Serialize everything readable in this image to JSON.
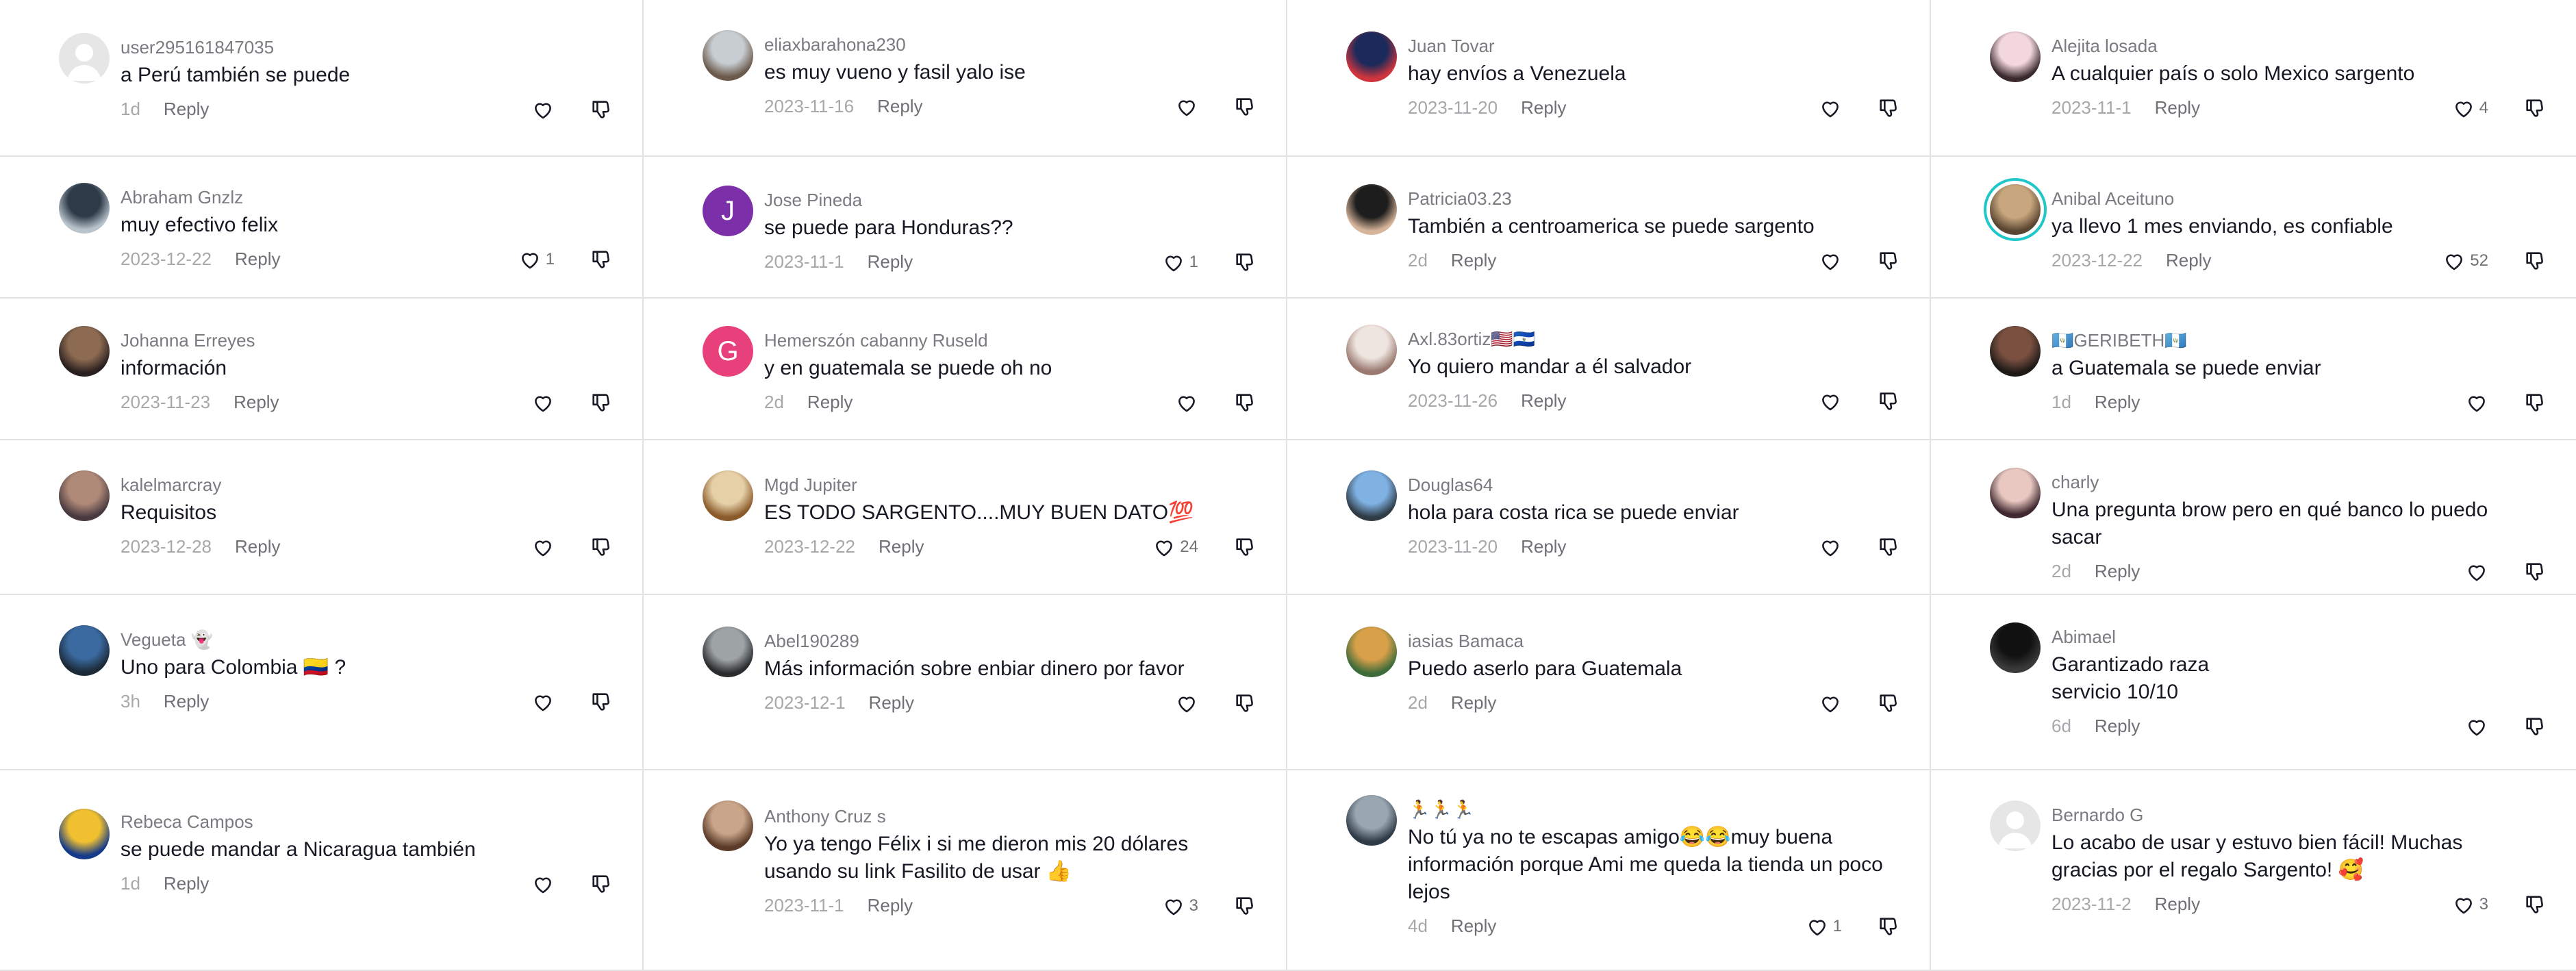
{
  "comments": [
    {
      "user": "user295161847035",
      "text": "a Perú también se puede",
      "date": "1d",
      "reply": "Reply",
      "likes": "",
      "avatar": {
        "type": "default"
      }
    },
    {
      "user": "eliaxbarahona230",
      "text": "es muy vueno y fasil yalo ise",
      "date": "2023-11-16",
      "reply": "Reply",
      "likes": "",
      "avatar": {
        "type": "photo",
        "colors": [
          "#c8cdd2",
          "#6b5a4c"
        ]
      }
    },
    {
      "user": "Juan Tovar",
      "text": "hay envíos a Venezuela",
      "date": "2023-11-20",
      "reply": "Reply",
      "likes": "",
      "avatar": {
        "type": "photo",
        "colors": [
          "#1b2a5a",
          "#d0353e"
        ]
      }
    },
    {
      "user": "Alejita losada",
      "text": "A cualquier país o solo Mexico sargento",
      "date": "2023-11-1",
      "reply": "Reply",
      "likes": "4",
      "avatar": {
        "type": "photo",
        "colors": [
          "#f3d7de",
          "#3a2a2e"
        ]
      }
    },
    {
      "user": "Abraham Gnzlz",
      "text": "muy efectivo felix",
      "date": "2023-12-22",
      "reply": "Reply",
      "likes": "1",
      "avatar": {
        "type": "photo",
        "colors": [
          "#2d3a47",
          "#b8c3cc"
        ]
      }
    },
    {
      "user": "Jose Pineda",
      "text": "se puede para Honduras??",
      "date": "2023-11-1",
      "reply": "Reply",
      "likes": "1",
      "avatar": {
        "type": "letter",
        "letter": "J",
        "color": "#7b2fa8"
      }
    },
    {
      "user": "Patricia03.23",
      "text": "También a centroamerica se puede sargento",
      "date": "2d",
      "reply": "Reply",
      "likes": "",
      "avatar": {
        "type": "photo",
        "colors": [
          "#1d1d1d",
          "#d7b59a"
        ]
      }
    },
    {
      "user": "Anibal Aceituno",
      "text": "ya llevo 1 mes enviando, es confiable",
      "date": "2023-12-22",
      "reply": "Reply",
      "likes": "52",
      "avatar": {
        "type": "photo",
        "ring": true,
        "colors": [
          "#c9a77e",
          "#5a4532"
        ]
      }
    },
    {
      "user": "Johanna Erreyes",
      "text": "información",
      "date": "2023-11-23",
      "reply": "Reply",
      "likes": "",
      "avatar": {
        "type": "photo",
        "colors": [
          "#8d6b52",
          "#2a2020"
        ]
      }
    },
    {
      "user": "Hemerszón cabanny Ruseld",
      "text": "y en guatemala se puede oh no",
      "date": "2d",
      "reply": "Reply",
      "likes": "",
      "avatar": {
        "type": "letter",
        "letter": "G",
        "color": "#e8407a"
      }
    },
    {
      "user": "Axl.83ortiz🇺🇸🇸🇻",
      "text": "Yo quiero mandar a él salvador",
      "date": "2023-11-26",
      "reply": "Reply",
      "likes": "",
      "avatar": {
        "type": "photo",
        "colors": [
          "#efe5e0",
          "#9a7a70"
        ]
      }
    },
    {
      "user": "🇬🇹GERIBETH🇬🇹",
      "text": "a Guatemala se puede enviar",
      "date": "1d",
      "reply": "Reply",
      "likes": "",
      "avatar": {
        "type": "photo",
        "colors": [
          "#7a5040",
          "#1e1a18"
        ]
      }
    },
    {
      "user": "kalelmarcray",
      "text": "Requisitos",
      "date": "2023-12-28",
      "reply": "Reply",
      "likes": "",
      "avatar": {
        "type": "photo",
        "colors": [
          "#b08a78",
          "#4a3a40"
        ]
      }
    },
    {
      "user": "Mgd Jupiter",
      "text": "ES TODO SARGENTO....MUY BUEN DATO💯",
      "date": "2023-12-22",
      "reply": "Reply",
      "likes": "24",
      "avatar": {
        "type": "photo",
        "colors": [
          "#e6d0a8",
          "#8a5a2a"
        ]
      }
    },
    {
      "user": "Douglas64",
      "text": "hola para costa rica se puede enviar",
      "date": "2023-11-20",
      "reply": "Reply",
      "likes": "",
      "avatar": {
        "type": "photo",
        "colors": [
          "#7fb1e3",
          "#2f3b45"
        ]
      }
    },
    {
      "user": "charly",
      "text": "Una pregunta brow pero en qué banco lo puedo sacar",
      "date": "2d",
      "reply": "Reply",
      "likes": "",
      "avatar": {
        "type": "photo",
        "colors": [
          "#e8c8c0",
          "#402830"
        ]
      }
    },
    {
      "user": "Vegueta 👻",
      "text": "Uno para Colombia 🇨🇴 ?",
      "date": "3h",
      "reply": "Reply",
      "likes": "",
      "avatar": {
        "type": "photo",
        "colors": [
          "#3b6aa0",
          "#1c2a38"
        ]
      }
    },
    {
      "user": "Abel190289",
      "text": "Más información sobre enbiar dinero por favor",
      "date": "2023-12-1",
      "reply": "Reply",
      "likes": "",
      "avatar": {
        "type": "photo",
        "colors": [
          "#9ea3a6",
          "#2a2c2e"
        ]
      }
    },
    {
      "user": "iasias Bamaca",
      "text": "Puedo aserlo para Guatemala",
      "date": "2d",
      "reply": "Reply",
      "likes": "",
      "avatar": {
        "type": "photo",
        "colors": [
          "#d9a04a",
          "#3d6b3a"
        ]
      }
    },
    {
      "user": "Abimael",
      "text": "Garantizado raza\nservicio 10/10",
      "date": "6d",
      "reply": "Reply",
      "likes": "",
      "avatar": {
        "type": "photo",
        "colors": [
          "#111111",
          "#3a3a3a"
        ]
      }
    },
    {
      "user": "Rebeca Campos",
      "text": "se puede mandar a Nicaragua también",
      "date": "1d",
      "reply": "Reply",
      "likes": "",
      "avatar": {
        "type": "photo",
        "colors": [
          "#f0c030",
          "#153a8a"
        ]
      }
    },
    {
      "user": "Anthony Cruz s",
      "text": "Yo ya tengo Félix i si me dieron mis 20 dólares usando su link Fasilito de usar 👍",
      "date": "2023-11-1",
      "reply": "Reply",
      "likes": "3",
      "avatar": {
        "type": "photo",
        "colors": [
          "#c9a58a",
          "#5a3a28"
        ]
      }
    },
    {
      "user": "🏃🏃🏃",
      "text": "No tú ya no te escapas amigo😂😂muy buena información porque Ami me queda la tienda un poco lejos",
      "date": "4d",
      "reply": "Reply",
      "likes": "1",
      "avatar": {
        "type": "photo",
        "colors": [
          "#9aa6b2",
          "#2e3a46"
        ]
      }
    },
    {
      "user": "Bernardo G",
      "text": "Lo acabo de usar y estuvo bien fácil! Muchas gracias por el regalo Sargento! 🥰",
      "date": "2023-11-2",
      "reply": "Reply",
      "likes": "3",
      "avatar": {
        "type": "default"
      }
    }
  ]
}
